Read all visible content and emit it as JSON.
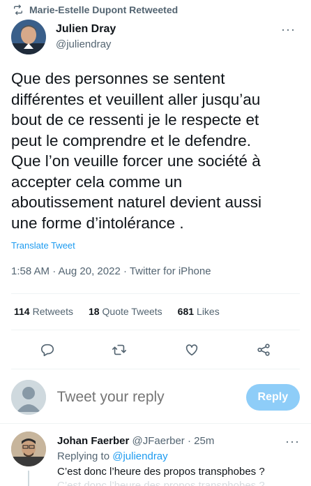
{
  "retweet_context": {
    "label": "Marie-Estelle Dupont Retweeted",
    "icon": "retweet-icon"
  },
  "author": {
    "display_name": "Julien Dray",
    "handle": "@juliendray",
    "more_icon": "more-icon",
    "more_label": "···"
  },
  "tweet": {
    "text": "Que des personnes se sentent\ndifférentes et veuillent aller jusqu’au\nbout de ce ressenti je le respecte et\npeut le comprendre et le defendre.\nQue l’on veuille forcer une société à\naccepter cela comme un\naboutissement naturel devient aussi\nune forme d’intolérance .",
    "translate_label": "Translate Tweet",
    "meta": "1:58 AM · Aug 20, 2022 · Twitter for iPhone"
  },
  "stats": {
    "retweets_count": "114",
    "retweets_label": "Retweets",
    "quotes_count": "18",
    "quotes_label": "Quote Tweets",
    "likes_count": "681",
    "likes_label": "Likes"
  },
  "actions": [
    "reply-icon",
    "retweet-icon",
    "like-icon",
    "share-icon"
  ],
  "reply_bar": {
    "placeholder": "Tweet your reply",
    "button_label": "Reply"
  },
  "reply": {
    "name": "Johan Faerber",
    "handle": "@JFaerber",
    "time": "· 25m",
    "replying_prefix": "Replying to ",
    "replying_handle": "@juliendray",
    "text": "C’est donc l’heure des propos transphobes ?",
    "text_faded": "C’est donc l’heure des propos transphobes ?",
    "more_label": "···"
  },
  "colors": {
    "accent": "#1d9bf0",
    "reply_button": "#8ecdf8",
    "secondary_text": "#536471"
  }
}
